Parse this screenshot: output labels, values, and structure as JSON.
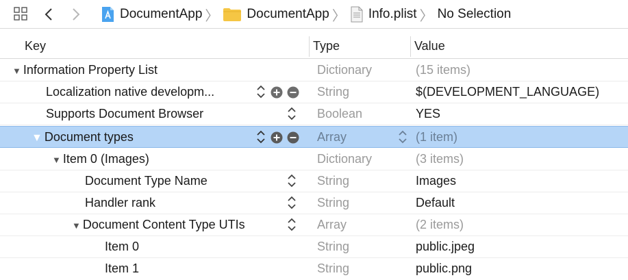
{
  "jumpbar": {
    "crumbs": [
      {
        "label": "DocumentApp",
        "icon": "xcode-project-icon"
      },
      {
        "label": "DocumentApp",
        "icon": "folder-icon"
      },
      {
        "label": "Info.plist",
        "icon": "plist-file-icon"
      },
      {
        "label": "No Selection",
        "icon": ""
      }
    ]
  },
  "columns": {
    "key": "Key",
    "type": "Type",
    "value": "Value"
  },
  "rows": [
    {
      "key": "Information Property List",
      "type": "Dictionary",
      "value": "(15 items)"
    },
    {
      "key": "Localization native developm...",
      "type": "String",
      "value": "$(DEVELOPMENT_LANGUAGE)"
    },
    {
      "key": "Supports Document Browser",
      "type": "Boolean",
      "value": "YES"
    },
    {
      "key": "Document types",
      "type": "Array",
      "value": "(1 item)"
    },
    {
      "key": "Item 0 (Images)",
      "type": "Dictionary",
      "value": "(3 items)"
    },
    {
      "key": "Document Type Name",
      "type": "String",
      "value": "Images"
    },
    {
      "key": "Handler rank",
      "type": "String",
      "value": "Default"
    },
    {
      "key": "Document Content Type UTIs",
      "type": "Array",
      "value": "(2 items)"
    },
    {
      "key": "Item 0",
      "type": "String",
      "value": "public.jpeg"
    },
    {
      "key": "Item 1",
      "type": "String",
      "value": "public.png"
    }
  ],
  "colors": {
    "selection": "#b5d5f7",
    "accent": "#1a73e8",
    "folder": "#f5c644"
  }
}
